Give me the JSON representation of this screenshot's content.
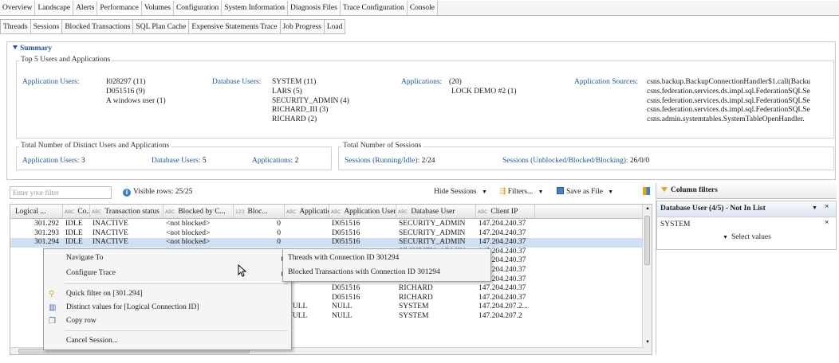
{
  "top_tabs": [
    "Overview",
    "Landscape",
    "Alerts",
    "Performance",
    "Volumes",
    "Configuration",
    "System Information",
    "Diagnosis Files",
    "Trace Configuration",
    "Console"
  ],
  "sub_tabs": [
    "Threads",
    "Sessions",
    "Blocked Transactions",
    "SQL Plan Cache",
    "Expensive Statements Trace",
    "Job Progress",
    "Load"
  ],
  "summary": {
    "title": "Summary",
    "top5_label": "Top 5 Users and Applications",
    "app_users_label": "Application Users:",
    "app_users": [
      "I028297 (11)",
      "D051516 (9)",
      "A windows user (1)"
    ],
    "db_users_label": "Database Users:",
    "db_users": [
      "SYSTEM (11)",
      "LARS (5)",
      "SECURITY_ADMIN (4)",
      "RICHARD_III (3)",
      "RICHARD (2)"
    ],
    "applications_label": "Applications:",
    "applications": [
      "(20)",
      "LOCK DEMO #2 (1)"
    ],
    "app_sources_label": "Application Sources:",
    "app_sources": [
      "csns.backup.BackupConnectionHandler$1.call(Backu",
      "csns.federation.services.ds.impl.sql.FederationSQLSe",
      "csns.federation.services.ds.impl.sql.FederationSQLSe",
      "csns.federation.services.ds.impl.sql.FederationSQLSe",
      "csns.admin.systemtables.SystemTableOpenHandler."
    ],
    "distinct_label": "Total Number of Distinct Users and Applications",
    "distinct_app_users": "Application Users:",
    "distinct_app_users_val": "3",
    "distinct_db_users": "Database Users:",
    "distinct_db_users_val": "5",
    "distinct_apps": "Applications:",
    "distinct_apps_val": "2",
    "sessions_label": "Total Number of Sessions",
    "sessions_running": "Sessions (Running/Idle):",
    "sessions_running_val": "2/24",
    "sessions_blocked": "Sessions (Unblocked/Blocked/Blocking):",
    "sessions_blocked_val": "26/0/0"
  },
  "toolbar": {
    "filter_placeholder": "Enter your filter",
    "visible_rows": "Visible rows: 25/25",
    "hide_sessions": "Hide Sessions",
    "filters": "Filters...",
    "save_as_file": "Save as File"
  },
  "table": {
    "columns": [
      "Logical ...",
      "Co...",
      "Transaction status",
      "Blocked by C...",
      "Bloc...",
      "Application",
      "Application User",
      "Database User",
      "Client IP"
    ],
    "col_abbr": [
      "",
      "ABC",
      "ABC",
      "ABC",
      "123",
      "ABC",
      "ABC",
      "ABC",
      "ABC"
    ],
    "rows": [
      [
        "301.292",
        "IDLE",
        "INACTIVE",
        "<not blocked>",
        "0",
        "",
        "D051516",
        "SECURITY_ADMIN",
        "147.204.240.37"
      ],
      [
        "301.293",
        "IDLE",
        "INACTIVE",
        "<not blocked>",
        "0",
        "",
        "D051516",
        "SECURITY_ADMIN",
        "147.204.240.37"
      ],
      [
        "301.294",
        "IDLE",
        "INACTIVE",
        "<not blocked>",
        "0",
        "",
        "D051516",
        "SECURITY_ADMIN",
        "147.204.240.37"
      ],
      [
        "",
        "",
        "",
        "",
        "",
        "",
        "",
        "SECURITY_ADMIN",
        "147.204.240.37"
      ],
      [
        "",
        "",
        "",
        "",
        "",
        "",
        "",
        "RICHARD_III",
        "147.204.240.37"
      ],
      [
        "",
        "",
        "",
        "",
        "0",
        "",
        "D051516",
        "RICHARD_III",
        "147.204.240.37"
      ],
      [
        "",
        "",
        "",
        "",
        "0",
        "",
        "D051516",
        "RICHARD_III",
        "147.204.240.37"
      ],
      [
        "",
        "",
        "",
        "",
        "0",
        "",
        "D051516",
        "RICHARD",
        "147.204.240.37"
      ],
      [
        "",
        "",
        "",
        "",
        "0",
        "",
        "D051516",
        "RICHARD",
        "147.204.240.37"
      ],
      [
        "",
        "",
        "",
        "",
        "0",
        "NULL",
        "NULL",
        "SYSTEM",
        "147.204.207.2..."
      ],
      [
        "",
        "",
        "",
        "",
        "0",
        "NULL",
        "NULL",
        "SYSTEM",
        "147.204.207.2"
      ]
    ]
  },
  "context_menu": {
    "navigate": "Navigate To",
    "configure": "Configure Trace",
    "quick_filter": "Quick filter on [301.294]",
    "distinct": "Distinct values for [Logical Connection ID]",
    "copy": "Copy row",
    "cancel": "Cancel Session..."
  },
  "submenu": {
    "threads": "Threads with Connection ID 301294",
    "blocked": "Blocked Transactions with Connection ID 301294"
  },
  "column_filters": {
    "title": "Column filters",
    "filter_name": "Database User (4/5) - Not In List",
    "value": "SYSTEM",
    "select_values": "Select values"
  }
}
